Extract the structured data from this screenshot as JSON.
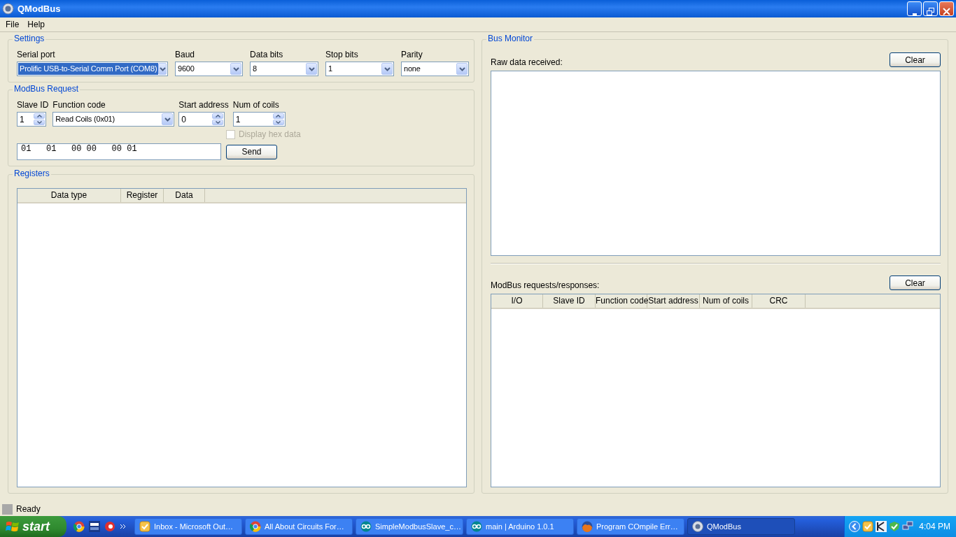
{
  "window": {
    "title": "QModBus"
  },
  "menu": [
    "File",
    "Help"
  ],
  "settings": {
    "title": "Settings",
    "fields": [
      {
        "label": "Serial port",
        "value": "Prolific USB-to-Serial Comm Port (COM8)",
        "highlighted": true
      },
      {
        "label": "Baud",
        "value": "9600",
        "highlighted": false
      },
      {
        "label": "Data bits",
        "value": "8",
        "highlighted": false
      },
      {
        "label": "Stop bits",
        "value": "1",
        "highlighted": false
      },
      {
        "label": "Parity",
        "value": "none",
        "highlighted": false
      }
    ]
  },
  "request": {
    "title": "ModBus Request",
    "fields": [
      {
        "kind": "spin",
        "label": "Slave ID",
        "value": "1"
      },
      {
        "kind": "combo",
        "label": "Function code",
        "value": "Read Coils (0x01)"
      },
      {
        "kind": "spin",
        "label": "Start address",
        "value": "0"
      },
      {
        "kind": "spin",
        "label": "Num of coils",
        "value": "1"
      }
    ],
    "hex_checkbox": {
      "label": "Display hex data",
      "checked": false,
      "disabled": true
    },
    "request_field": {
      "value": "01   01   00 00   00 01"
    },
    "send_button": "Send"
  },
  "registers": {
    "title": "Registers",
    "columns": [
      "Data type",
      "Register",
      "Data"
    ]
  },
  "bus_monitor": {
    "title": "Bus Monitor",
    "raw_label": "Raw data received:",
    "raw_clear_button": "Clear",
    "log_label": "ModBus requests/responses:",
    "log_clear_button": "Clear",
    "columns": [
      "I/O",
      "Slave ID",
      "Function code",
      "Start address",
      "Num of coils",
      "CRC"
    ]
  },
  "status_bar": {
    "text": "Ready"
  },
  "taskbar": {
    "start": "start",
    "tasks": [
      {
        "kind": "mail",
        "label": "Inbox - Microsoft Out…",
        "selected": false
      },
      {
        "kind": "browser",
        "label": "All About Circuits For…",
        "selected": false
      },
      {
        "kind": "loop",
        "label": "SimpleModbusSlave_c…",
        "selected": false
      },
      {
        "kind": "loop",
        "label": "main | Arduino 1.0.1",
        "selected": false
      },
      {
        "kind": "globe",
        "label": "Program COmpile Err…",
        "selected": false
      },
      {
        "kind": "app",
        "label": "QModBus",
        "selected": true
      }
    ],
    "clock": "4:04 PM"
  }
}
